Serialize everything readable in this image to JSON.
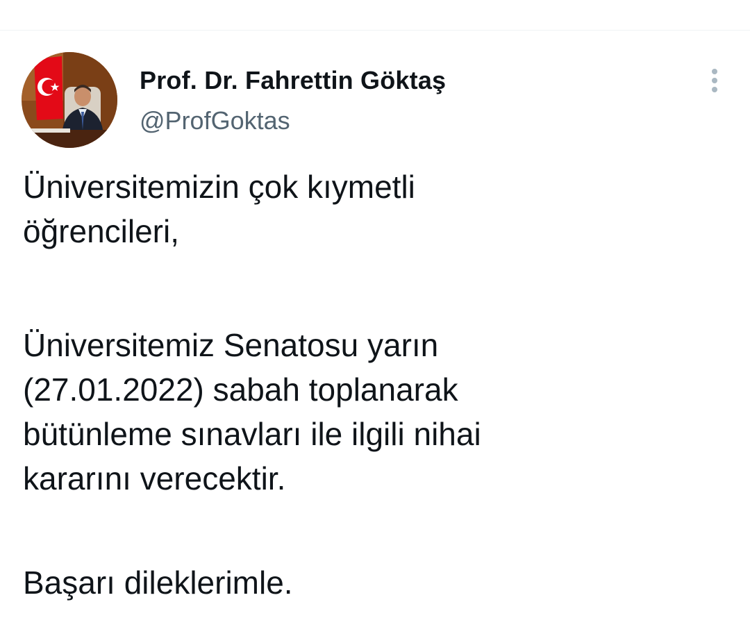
{
  "tweet": {
    "author": {
      "display_name": "Prof. Dr. Fahrettin Göktaş",
      "handle": "@ProfGoktas",
      "avatar_icon": "profile-photo"
    },
    "more_icon": "more-options-icon",
    "paragraphs": [
      "Üniversitemizin çok kıymetli\nöğrencileri,",
      "Üniversitemiz Senatosu yarın\n(27.01.2022) sabah toplanarak\nbütünleme sınavları ile ilgili nihai\nkararını verecektir.",
      "Başarı dileklerimle."
    ]
  },
  "colors": {
    "text_primary": "#0f1419",
    "text_secondary": "#536471",
    "divider": "#eff3f4",
    "more_dots": "#aab8c2"
  }
}
